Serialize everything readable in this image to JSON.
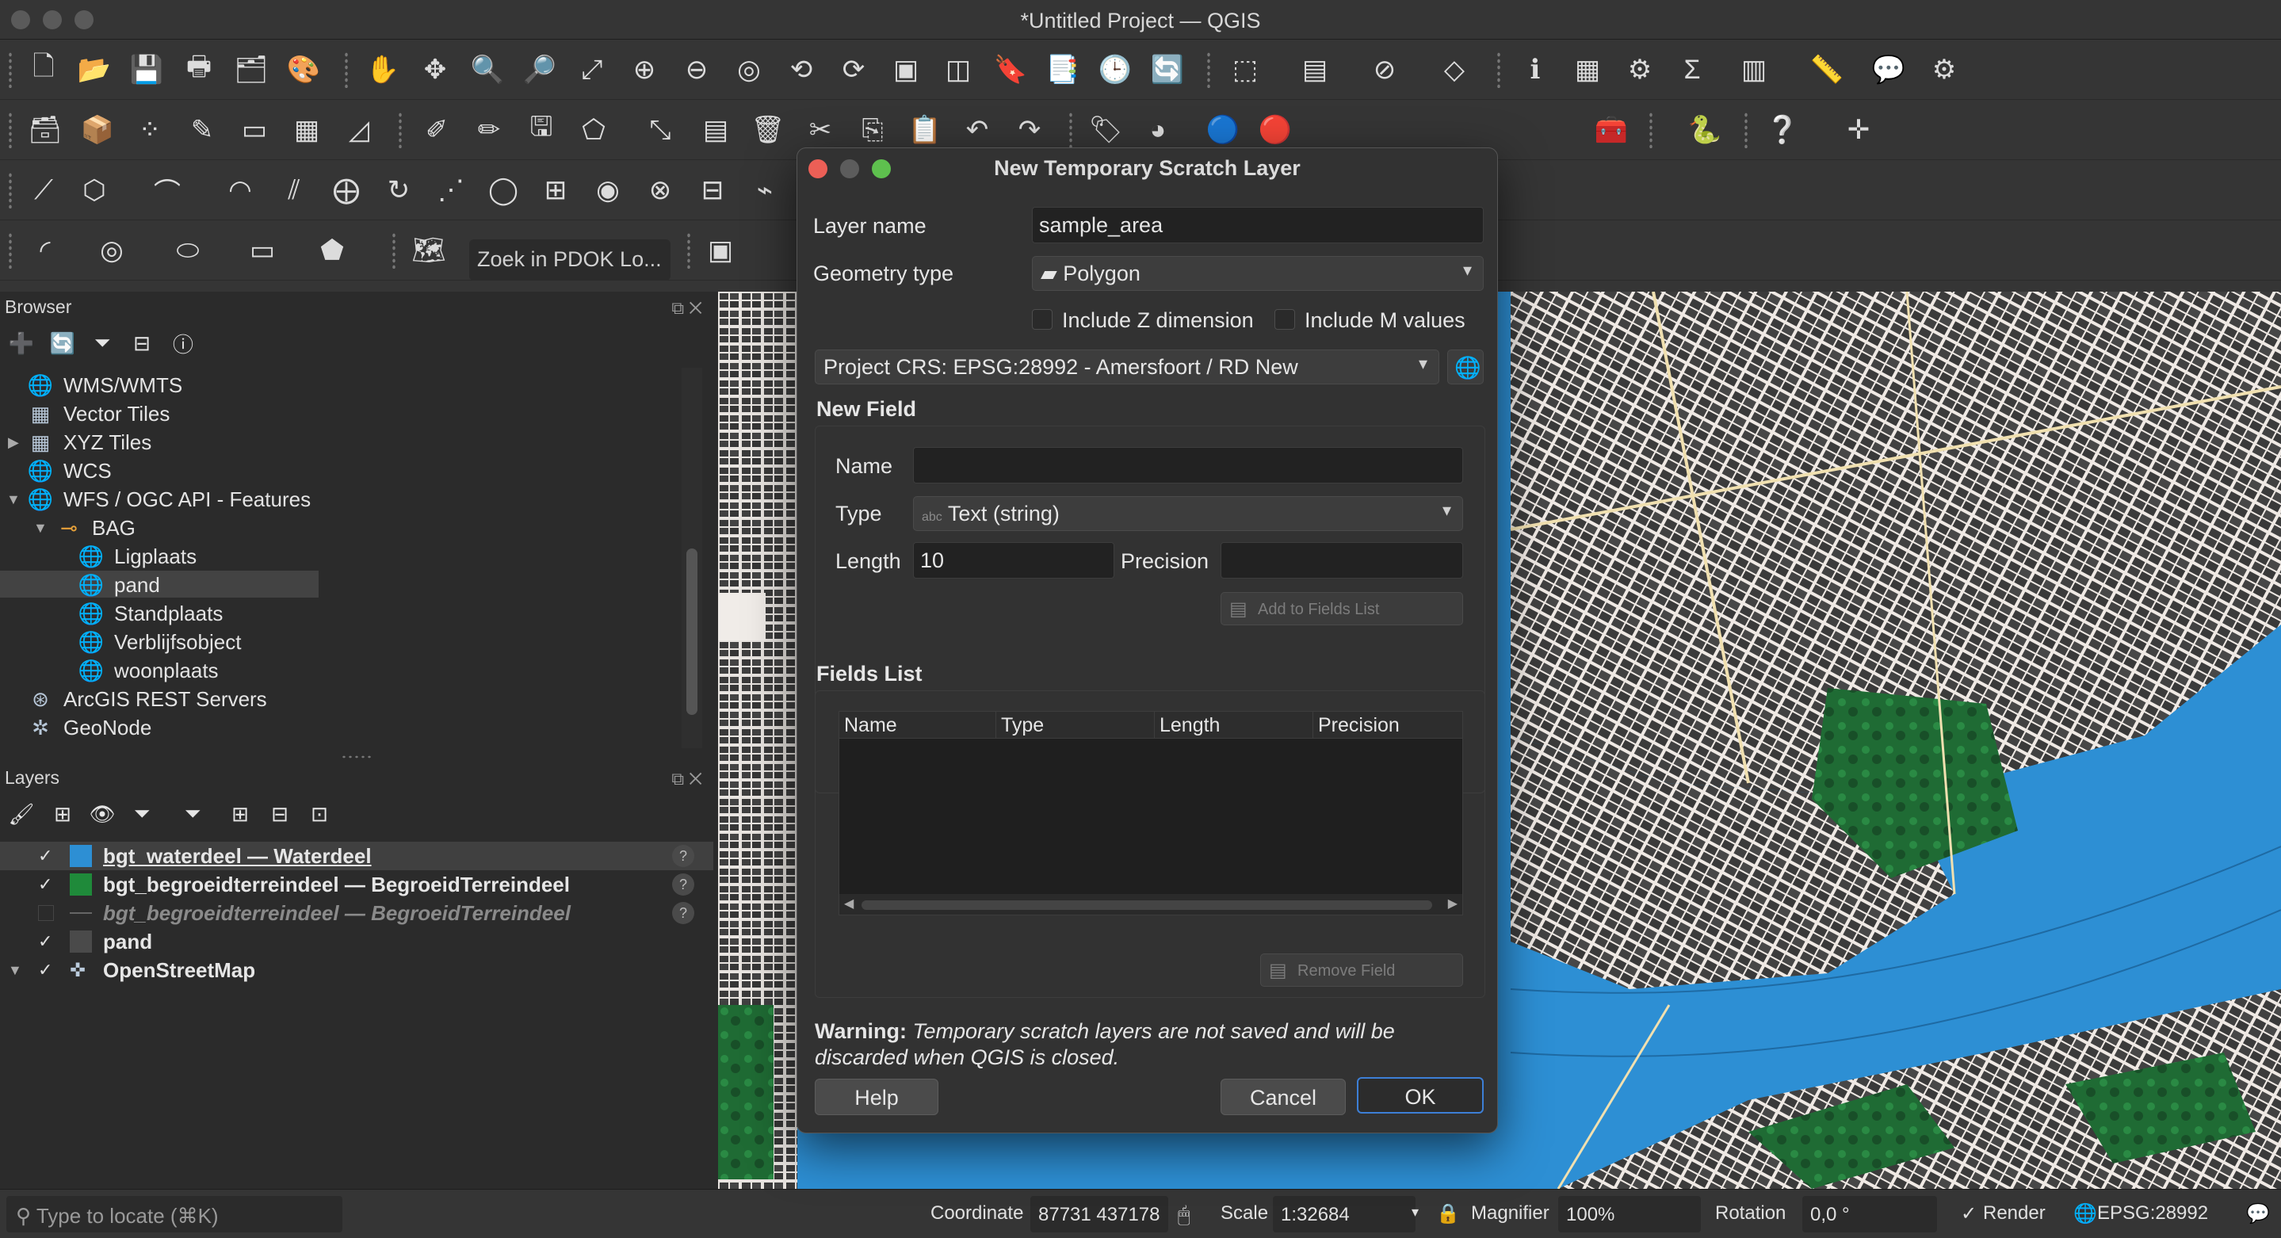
{
  "window": {
    "title": "*Untitled Project — QGIS"
  },
  "toolbar": {
    "pdok_search": "Zoek in PDOK Lo..."
  },
  "browser": {
    "title": "Browser",
    "items": {
      "wms": "WMS/WMTS",
      "vector_tiles": "Vector Tiles",
      "xyz": "XYZ Tiles",
      "wcs": "WCS",
      "wfs": "WFS / OGC API - Features",
      "bag": "BAG",
      "ligplaats": "Ligplaats",
      "pand": "pand",
      "standplaats": "Standplaats",
      "verblijfsobject": "Verblijfsobject",
      "woonplaats": "woonplaats",
      "arcgis": "ArcGIS REST Servers",
      "geonode": "GeoNode"
    }
  },
  "layers": {
    "title": "Layers",
    "rows": [
      {
        "label": "bgt_waterdeel — Waterdeel",
        "checked": "✓",
        "color": "#2d8fd4"
      },
      {
        "label": "bgt_begroeidterreindeel — BegroeidTerreindeel",
        "checked": "✓",
        "color": "#1f8a3a"
      },
      {
        "label": "bgt_begroeidterreindeel — BegroeidTerreindeel",
        "checked": "",
        "color": "#555555"
      },
      {
        "label": "pand",
        "checked": "✓",
        "color": "#4a4a4a"
      },
      {
        "label": "OpenStreetMap",
        "checked": "✓",
        "color": ""
      }
    ]
  },
  "dialog": {
    "title": "New Temporary Scratch Layer",
    "layer_name_label": "Layer name",
    "layer_name_value": "sample_area",
    "geometry_type_label": "Geometry type",
    "geometry_type_value": "Polygon",
    "include_z": "Include Z dimension",
    "include_m": "Include M values",
    "crs_value": "Project CRS: EPSG:28992 - Amersfoort / RD New",
    "new_field_title": "New Field",
    "name_label": "Name",
    "name_value": "",
    "type_label": "Type",
    "type_value": "Text (string)",
    "type_badge": "abc",
    "length_label": "Length",
    "length_value": "10",
    "precision_label": "Precision",
    "precision_value": "",
    "add_to_fields": "Add to Fields List",
    "fields_list_title": "Fields List",
    "columns": [
      "Name",
      "Type",
      "Length",
      "Precision"
    ],
    "remove_field": "Remove Field",
    "warning_bold": "Warning:",
    "warning_text": "Temporary scratch layers are not saved and will be discarded when QGIS is closed.",
    "help": "Help",
    "cancel": "Cancel",
    "ok": "OK"
  },
  "statusbar": {
    "locate_placeholder": "Type to locate (⌘K)",
    "coordinate_label": "Coordinate",
    "coordinate_value": "87731 437178",
    "scale_label": "Scale",
    "scale_value": "1:32684",
    "magnifier_label": "Magnifier",
    "magnifier_value": "100%",
    "rotation_label": "Rotation",
    "rotation_value": "0,0 °",
    "render_label": "Render",
    "render_checked": "✓",
    "crs": "EPSG:28992"
  },
  "colors": {
    "accent": "#3d7fd6",
    "water": "#2d8fd4",
    "vegetation": "#1f8a3a"
  }
}
